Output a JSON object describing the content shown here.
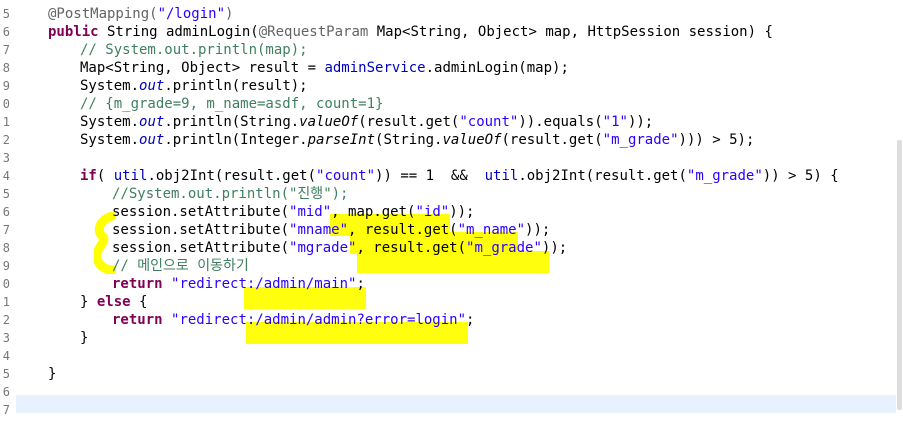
{
  "editor": {
    "gutter_numbers": [
      "5",
      "6",
      "7",
      "8",
      "9",
      "0",
      "1",
      "2",
      "3",
      "4",
      "5",
      "6",
      "7",
      "8",
      "9",
      "0",
      "1",
      "2",
      "3",
      "4",
      "5",
      "6",
      "7"
    ],
    "lines": [
      {
        "segments": [
          {
            "t": "@PostMapping(",
            "c": "ann"
          },
          {
            "t": "\"/login\"",
            "c": "str"
          },
          {
            "t": ")",
            "c": "ann"
          }
        ]
      },
      {
        "segments": [
          {
            "t": "public",
            "c": "kw"
          },
          {
            "t": " String adminLogin(",
            "c": ""
          },
          {
            "t": "@RequestParam",
            "c": "ann"
          },
          {
            "t": " Map<String, Object> map, HttpSession session) {",
            "c": ""
          }
        ]
      },
      {
        "indent": 1,
        "segments": [
          {
            "t": "// System.out.println(map);",
            "c": "cm"
          }
        ]
      },
      {
        "indent": 1,
        "segments": [
          {
            "t": "Map<String, Object> result = ",
            "c": ""
          },
          {
            "t": "adminService",
            "c": "fld2"
          },
          {
            "t": ".adminLogin(map);",
            "c": ""
          }
        ]
      },
      {
        "indent": 1,
        "segments": [
          {
            "t": "System.",
            "c": ""
          },
          {
            "t": "out",
            "c": "fld"
          },
          {
            "t": ".println(result);",
            "c": ""
          }
        ]
      },
      {
        "indent": 1,
        "segments": [
          {
            "t": "// {m_grade=9, m_name=asdf, count=1}",
            "c": "cm"
          }
        ]
      },
      {
        "indent": 1,
        "segments": [
          {
            "t": "System.",
            "c": ""
          },
          {
            "t": "out",
            "c": "fld"
          },
          {
            "t": ".println(String.",
            "c": ""
          },
          {
            "t": "valueOf",
            "c": "sm"
          },
          {
            "t": "(result.get(",
            "c": ""
          },
          {
            "t": "\"count\"",
            "c": "str"
          },
          {
            "t": ")).equals(",
            "c": ""
          },
          {
            "t": "\"1\"",
            "c": "str"
          },
          {
            "t": "));",
            "c": ""
          }
        ]
      },
      {
        "indent": 1,
        "segments": [
          {
            "t": "System.",
            "c": ""
          },
          {
            "t": "out",
            "c": "fld"
          },
          {
            "t": ".println(Integer.",
            "c": ""
          },
          {
            "t": "parseInt",
            "c": "sm"
          },
          {
            "t": "(String.",
            "c": ""
          },
          {
            "t": "valueOf",
            "c": "sm"
          },
          {
            "t": "(result.get(",
            "c": ""
          },
          {
            "t": "\"m_grade\"",
            "c": "str"
          },
          {
            "t": "))) > 5);",
            "c": ""
          }
        ]
      },
      {
        "segments": []
      },
      {
        "indent": 1,
        "segments": [
          {
            "t": "if",
            "c": "kw"
          },
          {
            "t": "( ",
            "c": ""
          },
          {
            "t": "util",
            "c": "fld2"
          },
          {
            "t": ".obj2Int(result.get(",
            "c": ""
          },
          {
            "t": "\"count\"",
            "c": "str"
          },
          {
            "t": ")) == 1  &&  ",
            "c": ""
          },
          {
            "t": "util",
            "c": "fld2"
          },
          {
            "t": ".obj2Int(result.get(",
            "c": ""
          },
          {
            "t": "\"m_grade\"",
            "c": "str"
          },
          {
            "t": ")) > 5) {",
            "c": ""
          }
        ]
      },
      {
        "indent": 2,
        "segments": [
          {
            "t": "//System.out.println(\"진행\");",
            "c": "cm"
          }
        ]
      },
      {
        "indent": 2,
        "segments": [
          {
            "t": "session.setAttribute(",
            "c": ""
          },
          {
            "t": "\"mid\"",
            "c": "str"
          },
          {
            "t": ", map.get(",
            "c": ""
          },
          {
            "t": "\"id\"",
            "c": "str"
          },
          {
            "t": "));",
            "c": ""
          }
        ]
      },
      {
        "indent": 2,
        "segments": [
          {
            "t": "session.setAttribute(",
            "c": ""
          },
          {
            "t": "\"mname\"",
            "c": "str"
          },
          {
            "t": ", result.get(",
            "c": ""
          },
          {
            "t": "\"m_name\"",
            "c": "str"
          },
          {
            "t": "));",
            "c": ""
          }
        ]
      },
      {
        "indent": 2,
        "segments": [
          {
            "t": "session.setAttribute(",
            "c": ""
          },
          {
            "t": "\"mgrade\"",
            "c": "str"
          },
          {
            "t": ", result.get(",
            "c": ""
          },
          {
            "t": "\"m_grade\"",
            "c": "str"
          },
          {
            "t": "));",
            "c": ""
          }
        ]
      },
      {
        "indent": 2,
        "segments": [
          {
            "t": "// 메인으로 이동하기",
            "c": "cm"
          }
        ]
      },
      {
        "indent": 2,
        "segments": [
          {
            "t": "return",
            "c": "kw"
          },
          {
            "t": " ",
            "c": ""
          },
          {
            "t": "\"redirect:/admin/main\"",
            "c": "str"
          },
          {
            "t": ";",
            "c": ""
          }
        ]
      },
      {
        "indent": 1,
        "segments": [
          {
            "t": "} ",
            "c": ""
          },
          {
            "t": "else",
            "c": "kw"
          },
          {
            "t": " {",
            "c": ""
          }
        ]
      },
      {
        "indent": 2,
        "segments": [
          {
            "t": "return",
            "c": "kw"
          },
          {
            "t": " ",
            "c": ""
          },
          {
            "t": "\"redirect:/admin/admin?error=login\"",
            "c": "str"
          },
          {
            "t": ";",
            "c": ""
          }
        ]
      },
      {
        "indent": 1,
        "segments": [
          {
            "t": "}",
            "c": ""
          }
        ]
      },
      {
        "segments": []
      },
      {
        "segments": [
          {
            "t": "}",
            "c": ""
          }
        ]
      },
      {
        "segments": []
      },
      {
        "segments": []
      }
    ]
  },
  "colors": {
    "keyword": "#7f0055",
    "annotation": "#646464",
    "string": "#2a00ff",
    "comment": "#3f7f5f",
    "field": "#0000c0",
    "highlight": "#ffff00",
    "current_line": "#e8f2fe"
  }
}
